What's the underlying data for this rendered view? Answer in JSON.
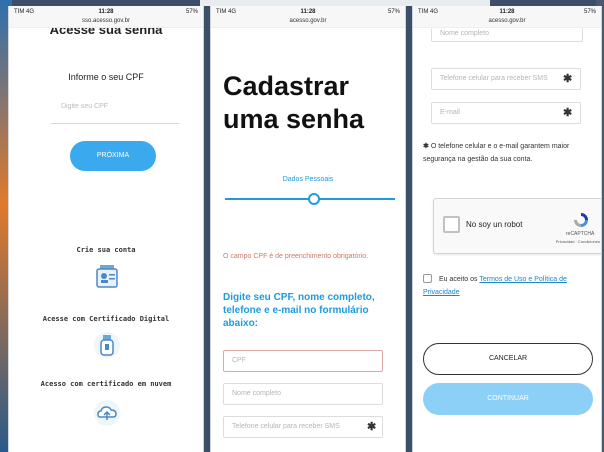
{
  "screen1": {
    "status": {
      "carrier": "TIM 4G",
      "time": "11:28",
      "battery": "57%",
      "url": "sso.acesso.gov.br"
    },
    "header_partial": "Acesse sua senha",
    "prompt": "Informe o seu CPF",
    "cpf_placeholder": "Digite seu CPF",
    "next_button": "PRÓXIMA",
    "create_account": "Crie sua conta",
    "digital_certificate": "Acesse com Certificado Digital",
    "cloud_certificate": "Acesso com certificado em nuvem"
  },
  "screen2": {
    "status": {
      "carrier": "TIM 4G",
      "time": "11:28",
      "battery": "57%",
      "url": "acesso.gov.br"
    },
    "title_line1": "Cadastrar",
    "title_line2": "uma senha",
    "step_label": "Dados Pessoais",
    "required_msg": "O campo CPF é de preenchimento obrigatório.",
    "instruction": "Digite seu CPF, nome completo, telefone e e-mail no formulário abaixo:",
    "cpf_placeholder": "CPF",
    "name_placeholder": "Nome completo",
    "phone_placeholder": "Telefone celular para receber SMS"
  },
  "screen3": {
    "status": {
      "carrier": "TIM 4G",
      "time": "11:28",
      "battery": "57%",
      "url": "acesso.gov.br"
    },
    "name_placeholder": "Nome completo",
    "phone_placeholder": "Telefone celular para receber SMS",
    "email_placeholder": "E-mail",
    "note": "O telefone celular e o e-mail garantem maior segurança na gestão da sua conta.",
    "recaptcha_label": "No soy un robot",
    "recaptcha_brand": "reCAPTCHA",
    "recaptcha_links": "Privacidad · Condiciones",
    "terms_prefix": "Eu aceito os",
    "terms_link": "Termos de Uso e Política de Privacidade",
    "cancel_button": "CANCELAR",
    "continue_button": "CONTINUAR"
  },
  "colors": {
    "accent": "#1e9be0",
    "button": "#3aa9ee",
    "continue": "#8ccff7",
    "link": "#1b86c9",
    "error": "#c97b63"
  }
}
